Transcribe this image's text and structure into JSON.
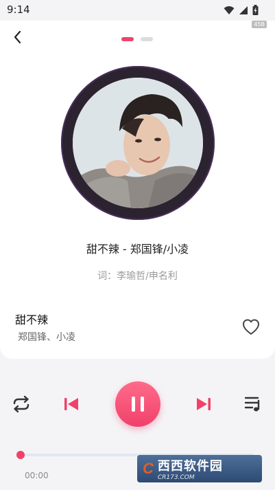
{
  "status_bar": {
    "time": "9:14",
    "net_badge": "45B"
  },
  "player": {
    "song_line": "甜不辣 - 郑国锋/小凌",
    "lyricist_line": "词：李瑜哲/申名利",
    "name": "甜不辣",
    "artists": "郑国锋、小凌",
    "current_time": "00:00",
    "progress": 0.0,
    "page_index": 0,
    "page_count": 2
  },
  "icons": {
    "back": "back-arrow-icon",
    "like": "heart-outline-icon",
    "repeat": "repeat-icon",
    "previous": "skip-previous-icon",
    "pause": "pause-icon",
    "next": "skip-next-icon",
    "playlist": "playlist-icon"
  },
  "colors": {
    "accent": "#f0416a",
    "disc": "#2c2331",
    "background": "#f4f4f6"
  },
  "watermark": {
    "logo": "C",
    "title": "西西软件园",
    "sub": "CR173.COM"
  }
}
